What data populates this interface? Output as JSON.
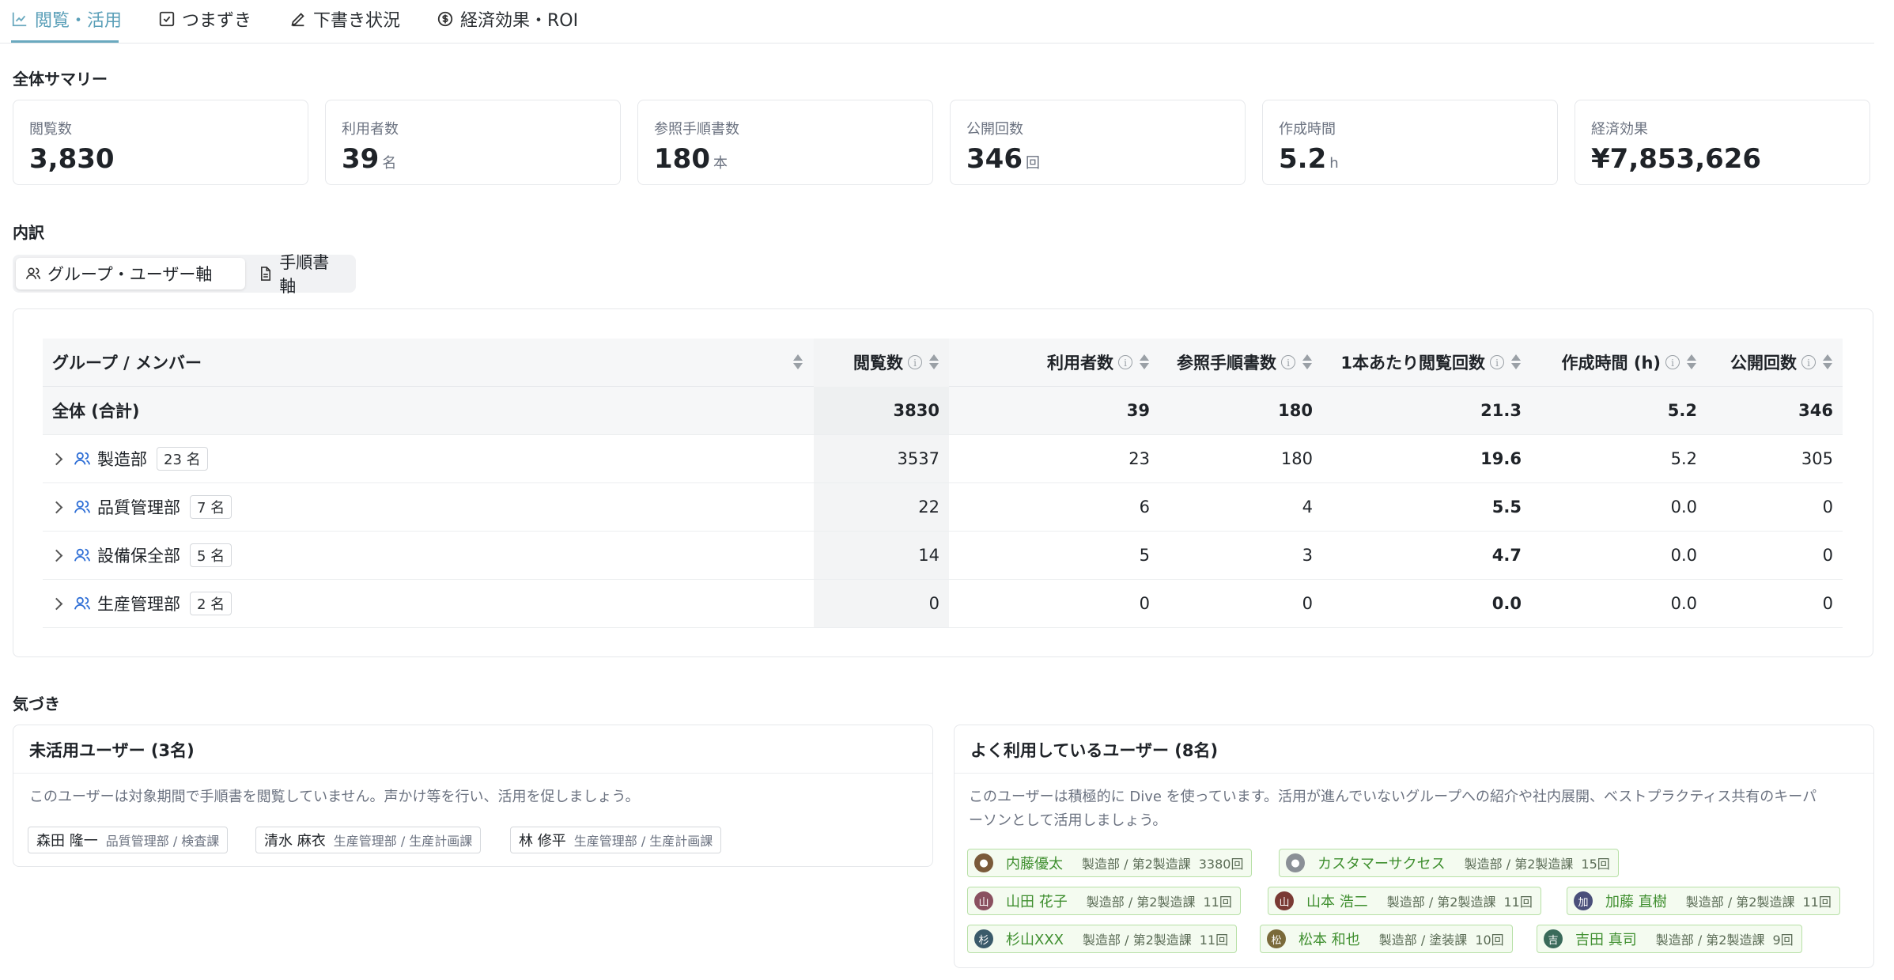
{
  "tabs": [
    {
      "label": "閲覧・活用",
      "icon": "chart-icon"
    },
    {
      "label": "つまずき",
      "icon": "checkbox-icon"
    },
    {
      "label": "下書き状況",
      "icon": "pencil-icon"
    },
    {
      "label": "経済効果・ROI",
      "icon": "dollar-circle-icon"
    }
  ],
  "summary": {
    "title": "全体サマリー",
    "cards": [
      {
        "label": "閲覧数",
        "value": "3,830",
        "unit": ""
      },
      {
        "label": "利用者数",
        "value": "39",
        "unit": "名"
      },
      {
        "label": "参照手順書数",
        "value": "180",
        "unit": "本"
      },
      {
        "label": "公開回数",
        "value": "346",
        "unit": "回"
      },
      {
        "label": "作成時間",
        "value": "5.2",
        "unit": "h"
      },
      {
        "label": "経済効果",
        "value": "¥7,853,626",
        "unit": ""
      }
    ]
  },
  "breakdown": {
    "title": "内訳",
    "toggle": [
      "グループ・ユーザー軸",
      "手順書軸"
    ],
    "columns": [
      "グループ / メンバー",
      "閲覧数",
      "利用者数",
      "参照手順書数",
      "1本あたり閲覧回数",
      "作成時間 (h)",
      "公開回数"
    ],
    "total": {
      "name": "全体 (合計)",
      "views": "3830",
      "users": "39",
      "docs": "180",
      "per_doc": "21.3",
      "hours": "5.2",
      "publishes": "346"
    },
    "rows": [
      {
        "name": "製造部",
        "members": "23 名",
        "views": "3537",
        "users": "23",
        "docs": "180",
        "per_doc": "19.6",
        "hours": "5.2",
        "publishes": "305"
      },
      {
        "name": "品質管理部",
        "members": "7 名",
        "views": "22",
        "users": "6",
        "docs": "4",
        "per_doc": "5.5",
        "hours": "0.0",
        "publishes": "0"
      },
      {
        "name": "設備保全部",
        "members": "5 名",
        "views": "14",
        "users": "5",
        "docs": "3",
        "per_doc": "4.7",
        "hours": "0.0",
        "publishes": "0"
      },
      {
        "name": "生産管理部",
        "members": "2 名",
        "views": "0",
        "users": "0",
        "docs": "0",
        "per_doc": "0.0",
        "hours": "0.0",
        "publishes": "0"
      }
    ]
  },
  "insights": {
    "title": "気づき",
    "inactive": {
      "title": "未活用ユーザー (3名)",
      "desc": "このユーザーは対象期間で手順書を閲覧していません。声かけ等を行い、活用を促しましょう。",
      "users": [
        {
          "name": "森田 隆一",
          "dept": "品質管理部 / 検査課"
        },
        {
          "name": "清水 麻衣",
          "dept": "生産管理部 / 生産計画課"
        },
        {
          "name": "林 修平",
          "dept": "生産管理部 / 生産計画課"
        }
      ]
    },
    "active": {
      "title": "よく利用しているユーザー (8名)",
      "desc_line1": "このユーザーは積極的に Dive を使っています。活用が進んでいないグループへの紹介や社内展開、ベストプラクティス共有のキーパ",
      "desc_line2": "ーソンとして活用しましょう。",
      "users": [
        {
          "initial": "",
          "name": "内藤優太",
          "dept": "製造部 / 第2製造課",
          "count": "3380回",
          "color": "#7a5a3a"
        },
        {
          "initial": "",
          "name": "カスタマーサクセス",
          "dept": "製造部 / 第2製造課",
          "count": "15回",
          "color": "#8a8f96"
        },
        {
          "initial": "山",
          "name": "山田 花子",
          "dept": "製造部 / 第2製造課",
          "count": "11回",
          "color": "#8a5060"
        },
        {
          "initial": "山",
          "name": "山本 浩二",
          "dept": "製造部 / 第2製造課",
          "count": "11回",
          "color": "#7a3a34"
        },
        {
          "initial": "加",
          "name": "加藤 直樹",
          "dept": "製造部 / 第2製造課",
          "count": "11回",
          "color": "#4a4f7a"
        },
        {
          "initial": "杉",
          "name": "杉山XXX",
          "dept": "製造部 / 第2製造課",
          "count": "11回",
          "color": "#3a5a6a"
        },
        {
          "initial": "松",
          "name": "松本 和也",
          "dept": "製造部 / 塗装課",
          "count": "10回",
          "color": "#7a6a3a"
        },
        {
          "initial": "吉",
          "name": "吉田 真司",
          "dept": "製造部 / 第2製造課",
          "count": "9回",
          "color": "#3a6a5a"
        }
      ]
    }
  }
}
